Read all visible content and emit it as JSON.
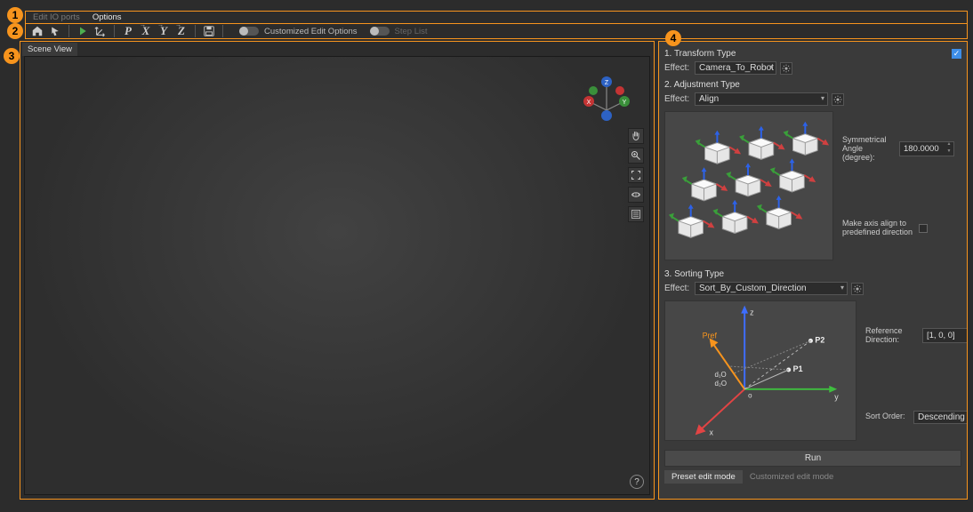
{
  "tabs": {
    "io": "Edit IO ports",
    "options": "Options"
  },
  "toolbar": {
    "toggle1_label": "Customized Edit Options",
    "toggle2_label": "Step List",
    "axis_p": "P",
    "axis_x": "X",
    "axis_y": "Y",
    "axis_z": "Z"
  },
  "scene_tab": "Scene View",
  "gizmo": {
    "x": "X",
    "y": "Y",
    "z": "Z"
  },
  "panel": {
    "transform": {
      "header": "1. Transform Type",
      "effect_label": "Effect:",
      "effect_value": "Camera_To_Robot"
    },
    "adjust": {
      "header": "2. Adjustment Type",
      "effect_label": "Effect:",
      "effect_value": "Align",
      "sym_label": "Symmetrical Angle (degree):",
      "sym_value": "180.0000",
      "align_label": "Make axis align to predefined direction"
    },
    "sort": {
      "header": "3. Sorting Type",
      "effect_label": "Effect:",
      "effect_value": "Sort_By_Custom_Direction",
      "ref_label": "Reference Direction:",
      "ref_value": "[1, 0, 0]",
      "order_label": "Sort Order:",
      "order_value": "Descending"
    },
    "run": "Run",
    "mode_preset": "Preset edit mode",
    "mode_custom": "Customized edit mode"
  },
  "help": "?",
  "sort_diagram": {
    "x": "x",
    "y": "y",
    "z": "z",
    "o": "o",
    "pref": "Pref",
    "p1": "P1",
    "p2": "P2",
    "d10": "d₁O",
    "d20": "d₂O"
  },
  "badges": {
    "b1": "1",
    "b2": "2",
    "b3": "3",
    "b4": "4"
  }
}
